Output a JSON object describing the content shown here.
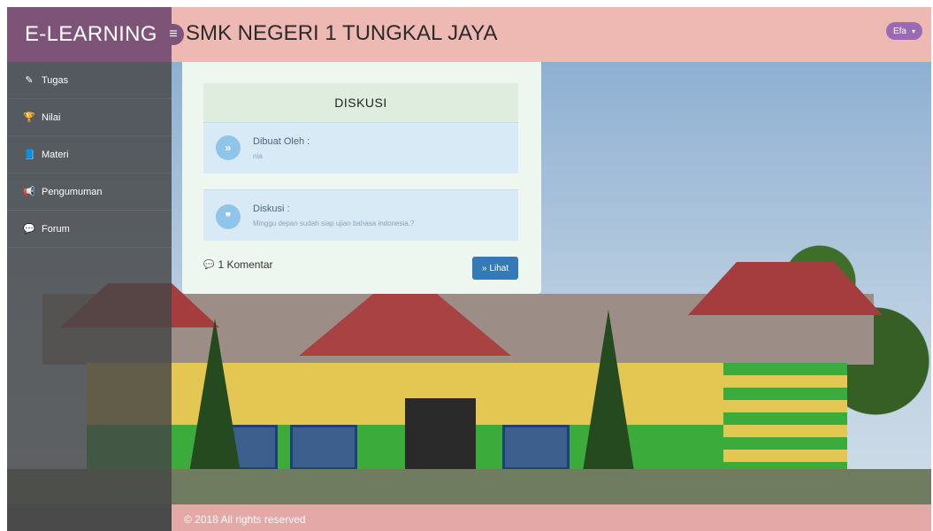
{
  "header": {
    "brand": "E-LEARNING",
    "toggle_icon": "≡",
    "title": "SMK NEGERI 1 TUNGKAL JAYA",
    "user": {
      "name": "Efa",
      "caret": "▾"
    }
  },
  "sidebar": {
    "items": [
      {
        "label": "Tugas",
        "icon": "✎",
        "icon_name": "pencil-icon"
      },
      {
        "label": "Nilai",
        "icon": "🏆",
        "icon_name": "trophy-icon"
      },
      {
        "label": "Materi",
        "icon": "📘",
        "icon_name": "book-icon"
      },
      {
        "label": "Pengumuman",
        "icon": "📢",
        "icon_name": "bullhorn-icon"
      },
      {
        "label": "Forum",
        "icon": "💬",
        "icon_name": "comments-icon"
      }
    ]
  },
  "card": {
    "heading": "DISKUSI",
    "author_box": {
      "icon": "»",
      "title": "Dibuat Oleh :",
      "value": "nia"
    },
    "discussion_box": {
      "icon": "❞",
      "title": "Diskusi :",
      "value": "Minggu depan sudah siap ujian bahasa indonesia.?"
    },
    "comments": {
      "icon": "💬",
      "label": "1 Komentar"
    },
    "view_button": {
      "icon": "»",
      "label": "Lihat"
    }
  },
  "footer": {
    "text": "© 2018 All rights reserved"
  },
  "colors": {
    "brand_bg": "#7d5478",
    "topbar_bg": "#efb9b3",
    "user_btn": "#9a6ab2",
    "primary_button": "#337ab7",
    "info_box": "#d9eaf7",
    "card_bg": "#eef7ef"
  }
}
